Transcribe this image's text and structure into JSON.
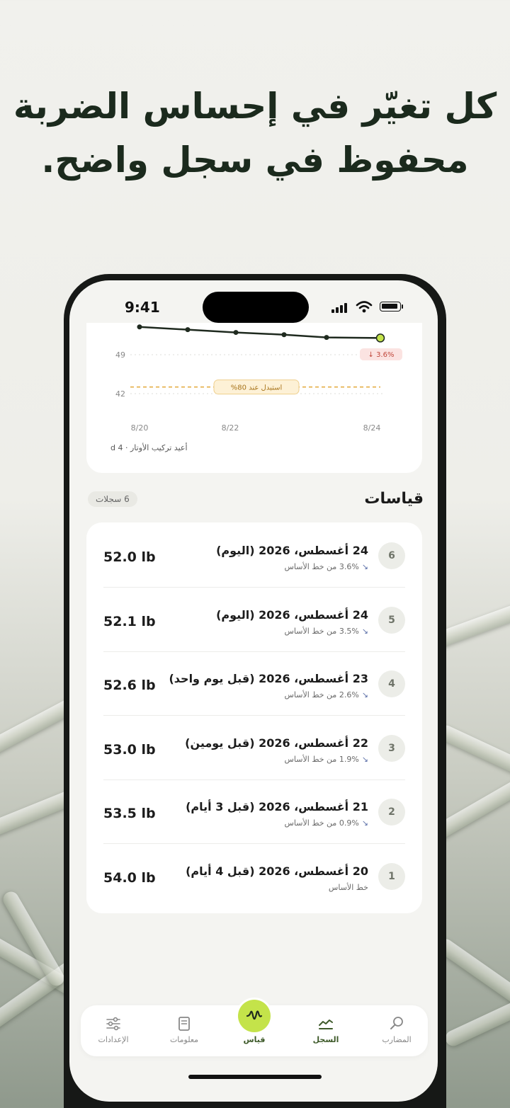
{
  "headline": {
    "line1": "كل تغيّر في إحساس الضربة",
    "line2": "محفوظ في سجل واضح."
  },
  "status_bar": {
    "time": "9:41"
  },
  "chart": {
    "hint": "أعيد تركيب الأوتار · 4 d",
    "replace_label": "استبدل عند 80%",
    "latest_change": "↓ 3.6%",
    "colors": {
      "line": "#1f2a1f",
      "latest_point": "#c4e34a",
      "threshold": "#e2a83a",
      "change_badge_bg": "#fbe3e1",
      "change_badge_text": "#c0473b"
    }
  },
  "chart_data": {
    "type": "line",
    "x": [
      "8/20",
      "8/21",
      "8/22",
      "8/23",
      "8/24",
      "8/24"
    ],
    "series": [
      {
        "values": [
          54.0,
          53.5,
          53.0,
          52.6,
          52.1,
          52.0
        ]
      }
    ],
    "x_tick_labels": [
      "8/20",
      "8/22",
      "8/24"
    ],
    "y_tick_labels": [
      49,
      42
    ],
    "threshold": {
      "value": 43.2,
      "label": "استبدل عند 80%"
    },
    "grid": true
  },
  "measurements": {
    "title": "قياسات",
    "count_label": "6 سجلات",
    "rows": [
      {
        "index": "6",
        "date": "24 أغسطس، 2026 (اليوم)",
        "delta": "3.6% من خط الأساس",
        "weight": "52.0 lb",
        "trend": true
      },
      {
        "index": "5",
        "date": "24 أغسطس، 2026 (اليوم)",
        "delta": "3.5% من خط الأساس",
        "weight": "52.1 lb",
        "trend": true
      },
      {
        "index": "4",
        "date": "23 أغسطس، 2026 (قبل يوم واحد)",
        "delta": "2.6% من خط الأساس",
        "weight": "52.6 lb",
        "trend": true
      },
      {
        "index": "3",
        "date": "22 أغسطس، 2026 (قبل يومين)",
        "delta": "1.9% من خط الأساس",
        "weight": "53.0 lb",
        "trend": true
      },
      {
        "index": "2",
        "date": "21 أغسطس، 2026 (قبل 3 أيام)",
        "delta": "0.9% من خط الأساس",
        "weight": "53.5 lb",
        "trend": true
      },
      {
        "index": "1",
        "date": "20 أغسطس، 2026 (قبل 4 أيام)",
        "delta": "خط الأساس",
        "weight": "54.0 lb",
        "trend": false
      }
    ]
  },
  "tabbar": {
    "racquets": "المضارب",
    "history": "السجل",
    "measure": "قياس",
    "info": "معلومات",
    "settings": "الإعدادات",
    "active": "history"
  }
}
